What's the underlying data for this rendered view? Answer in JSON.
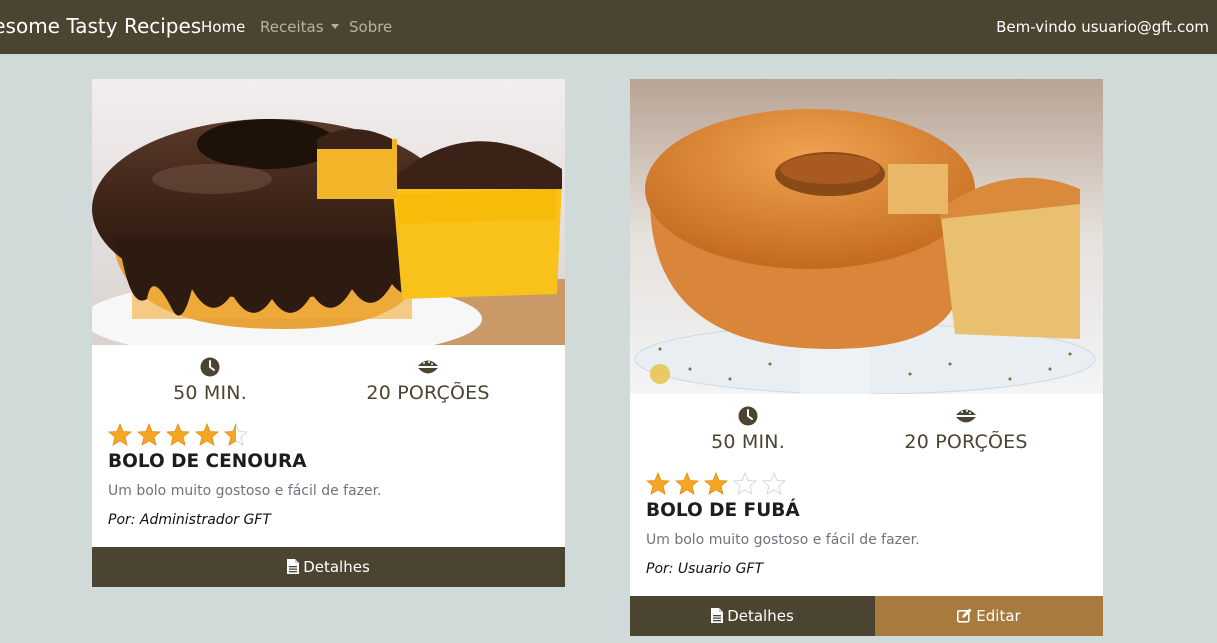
{
  "navbar": {
    "brand": "Awesome Tasty Recipes",
    "home": "Home",
    "receitas": "Receitas",
    "sobre": "Sobre",
    "welcome": "Bem-vindo usuario@gft.com"
  },
  "recipes": [
    {
      "time": "50 MIN.",
      "portions": "20 PORÇÕES",
      "rating": 4.5,
      "rating_max": 5,
      "title": "BOLO DE CENOURA",
      "description": "Um bolo muito gostoso e fácil de fazer.",
      "author": "Por: Administrador GFT",
      "details_label": "Detalhes"
    },
    {
      "time": "50 MIN.",
      "portions": "20 PORÇÕES",
      "rating": 3,
      "rating_max": 5,
      "title": "BOLO DE FUBÁ",
      "description": "Um bolo muito gostoso e fácil de fazer.",
      "author": "Por: Usuario GFT",
      "details_label": "Detalhes",
      "edit_label": "Editar"
    }
  ],
  "colors": {
    "navbar": "#4b4430",
    "background": "#cfdad9",
    "details_button": "#4b4430",
    "edit_button": "#a87a3e",
    "star": "#f5a623"
  }
}
